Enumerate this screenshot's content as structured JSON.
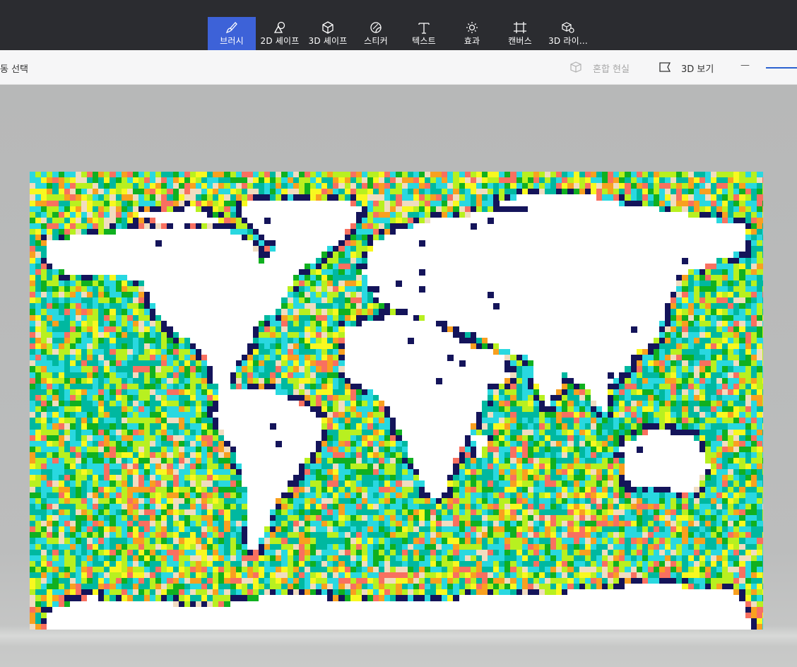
{
  "toolbar": {
    "items": [
      {
        "label": "브러시",
        "icon": "brush-icon",
        "active": true
      },
      {
        "label": "2D 셰이프",
        "icon": "2d-shapes-icon"
      },
      {
        "label": "3D 셰이프",
        "icon": "3d-shapes-icon"
      },
      {
        "label": "스티커",
        "icon": "sticker-icon"
      },
      {
        "label": "텍스트",
        "icon": "text-icon"
      },
      {
        "label": "효과",
        "icon": "effects-icon"
      },
      {
        "label": "캔버스",
        "icon": "canvas-icon"
      },
      {
        "label": "3D 라이...",
        "icon": "3d-library-icon"
      }
    ],
    "active_color": "#3d62d8"
  },
  "subbar": {
    "magic_select_label": "동 선택",
    "mixed_reality_label": "혼합 현실",
    "view_3d_label": "3D 보기",
    "minus_symbol": "—"
  },
  "canvas": {
    "description_icon": "world-map-pixel-art",
    "palette": {
      "land": "#ffffff",
      "coast": "#14145a",
      "teal": "#00b8a0",
      "cyan": "#29d8e0",
      "green": "#10b020",
      "lime": "#b8f020",
      "yellow": "#f8f820",
      "orange": "#f8a020",
      "salmon": "#f87060",
      "beige": "#f0dcc0"
    }
  }
}
